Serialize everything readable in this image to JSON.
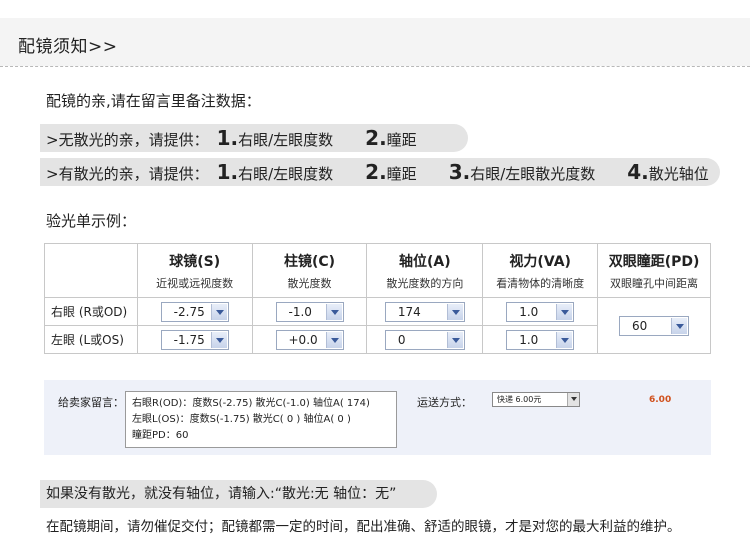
{
  "header": {
    "title": "配镜须知>>"
  },
  "intro": "配镜的亲,请在留言里备注数据：",
  "no_astig": {
    "prefix": ">无散光的亲，请提供：",
    "steps": [
      {
        "num": "1.",
        "label": "右眼/左眼度数"
      },
      {
        "num": "2.",
        "label": "瞳距"
      }
    ]
  },
  "with_astig": {
    "prefix": ">有散光的亲，请提供：",
    "steps": [
      {
        "num": "1.",
        "label": "右眼/左眼度数"
      },
      {
        "num": "2.",
        "label": "瞳距"
      },
      {
        "num": "3.",
        "label": "右眼/左眼散光度数"
      },
      {
        "num": "4.",
        "label": "散光轴位"
      }
    ]
  },
  "sample": {
    "title": "验光单示例：",
    "columns": [
      {
        "name": "球镜(S)",
        "desc": "近视或远视度数"
      },
      {
        "name": "柱镜(C)",
        "desc": "散光度数"
      },
      {
        "name": "轴位(A)",
        "desc": "散光度数的方向"
      },
      {
        "name": "视力(VA)",
        "desc": "看清物体的清晰度"
      },
      {
        "name": "双眼瞳距(PD)",
        "desc": "双眼瞳孔中间距离"
      }
    ],
    "rows": [
      {
        "label": "右眼 (R或OD)",
        "sphere": "-2.75",
        "cyl": "-1.0",
        "axis": "174",
        "va": "1.0"
      },
      {
        "label": "左眼 (L或OS)",
        "sphere": "-1.75",
        "cyl": "+0.0",
        "axis": "0",
        "va": "1.0"
      }
    ],
    "pd": "60"
  },
  "message": {
    "label": "给卖家留言：",
    "lines": [
      "右眼R(OD)：度数S(-2.75)   散光C(-1.0)   轴位A( 174)",
      "左眼L(OS)：度数S(-1.75)   散光C( 0 )     轴位A( 0 )",
      "瞳距PD：60"
    ],
    "shipping_label": "运送方式：",
    "shipping_value": "快递 6.00元",
    "shipping_price": "6.00"
  },
  "note": "如果没有散光，就没有轴位，请输入:“散光:无    轴位：无”",
  "footer": "在配镜期间，请勿催促交付；配镜都需一定的时间，配出准确、舒适的眼镜，才是对您的最大利益的维护。"
}
